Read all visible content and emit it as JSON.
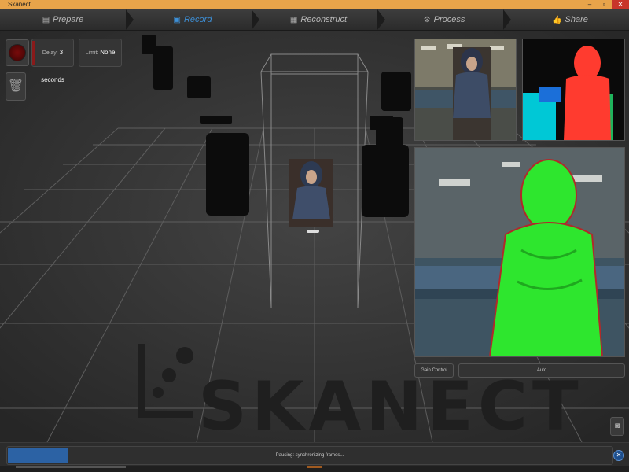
{
  "window": {
    "title": "Skanect"
  },
  "titlebar": {
    "minimize": "–",
    "maximize": "▫",
    "close": "✕"
  },
  "steps": [
    {
      "label": "Prepare",
      "icon": "document-icon",
      "glyph": "▤",
      "active": false
    },
    {
      "label": "Record",
      "icon": "record-icon",
      "glyph": "▣",
      "active": true
    },
    {
      "label": "Reconstruct",
      "icon": "grid-icon",
      "glyph": "▦",
      "active": false
    },
    {
      "label": "Process",
      "icon": "cog-icon",
      "glyph": "⚙",
      "active": false
    },
    {
      "label": "Share",
      "icon": "thumb-up-icon",
      "glyph": "👍",
      "active": false
    }
  ],
  "controls": {
    "delay_label": "Delay:",
    "delay_value": "3 seconds",
    "limit_label": "Limit:",
    "limit_value": "None",
    "gain_control_label": "Gain Control",
    "gain_mode": "Auto"
  },
  "status": {
    "message": "Pausing: synchronizing frames...",
    "progress": 0.1
  },
  "watermark": {
    "text": "SKANECT"
  },
  "colors": {
    "accent": "#3d8fd6",
    "titlebar": "#e8a44a",
    "record": "#7a0b0b",
    "progress": "#2c62a4",
    "mesh_green": "#2ee62e",
    "depth_red": "#ff3b2f",
    "depth_cyan": "#00c8d6"
  }
}
